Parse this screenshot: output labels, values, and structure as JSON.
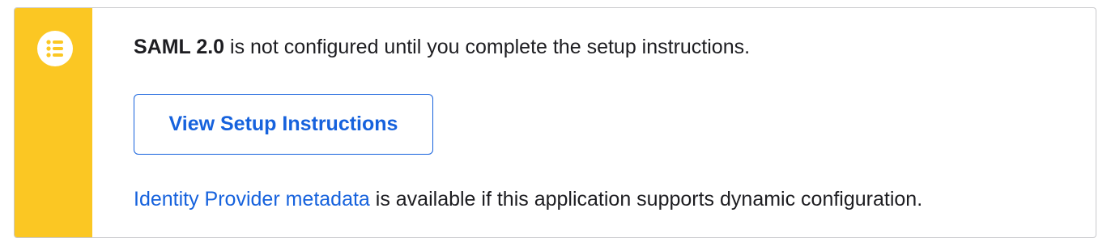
{
  "notice": {
    "icon": "list-icon",
    "accent_color": "#fbc723",
    "link_color": "#1662dd",
    "message_bold": "SAML 2.0",
    "message_rest": " is not configured until you complete the setup instructions.",
    "button_label": "View Setup Instructions",
    "metadata_link_label": "Identity Provider metadata",
    "metadata_rest": " is available if this application supports dynamic configuration."
  }
}
